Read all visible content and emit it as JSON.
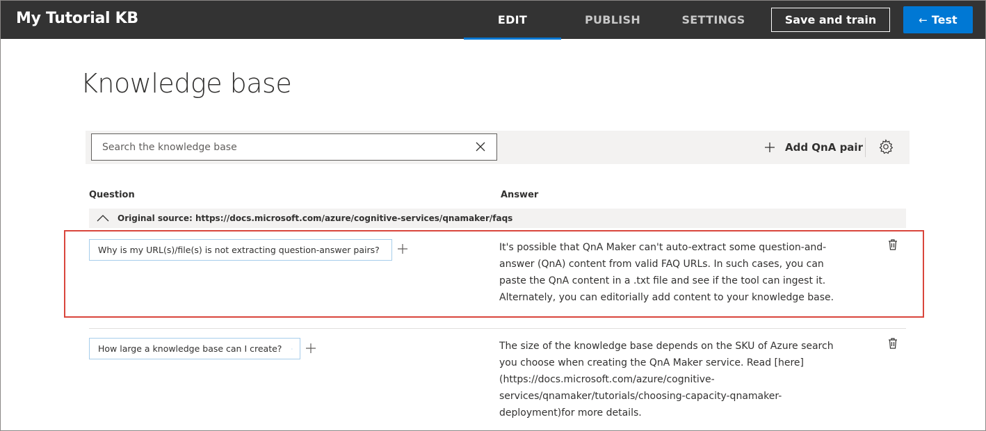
{
  "app": {
    "title": "My Tutorial KB"
  },
  "nav": {
    "tabs": [
      {
        "label": "EDIT",
        "active": true
      },
      {
        "label": "PUBLISH",
        "active": false
      },
      {
        "label": "SETTINGS",
        "active": false
      }
    ],
    "save_label": "Save and train",
    "test_label": "Test"
  },
  "page": {
    "title": "Knowledge base"
  },
  "toolbar": {
    "search_placeholder": "Search the knowledge base",
    "add_label": "Add QnA pair"
  },
  "table": {
    "question_header": "Question",
    "answer_header": "Answer",
    "source_label": "Original source: https://docs.microsoft.com/azure/cognitive-services/qnamaker/faqs",
    "rows": [
      {
        "question": "Why is my URL(s)/file(s) is not extracting question-answer pairs?",
        "answer_lines": [
          "It's possible that QnA Maker can't auto-extract some question-and-",
          "answer (QnA) content from valid FAQ URLs. In such cases, you can",
          "paste the QnA content in a .txt file and see if the tool can ingest it.",
          "Alternately, you can editorially add content to your knowledge base."
        ],
        "highlighted": true
      },
      {
        "question": "How large a knowledge base can I create?",
        "answer_lines": [
          "The size of the knowledge base depends on the SKU of Azure search",
          "you choose when creating the QnA Maker service. Read [here]",
          "(https://docs.microsoft.com/azure/cognitive-",
          "services/qnamaker/tutorials/choosing-capacity-qnamaker-",
          "deployment)for more details."
        ],
        "highlighted": false
      }
    ]
  },
  "colors": {
    "topbar": "#333333",
    "accent": "#0078d4",
    "highlight": "#d9453b"
  }
}
